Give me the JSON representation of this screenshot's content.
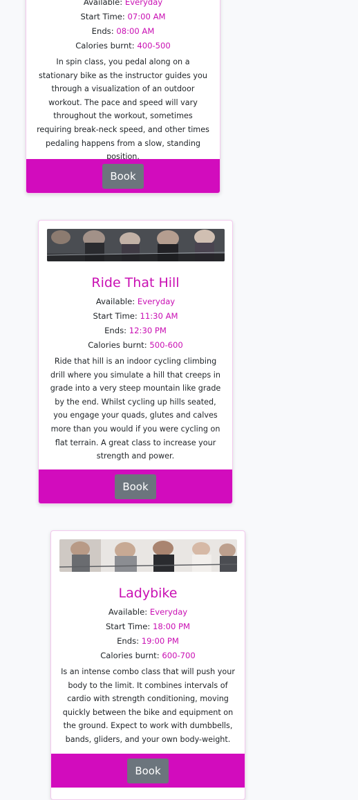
{
  "classes": [
    {
      "title": "",
      "available_label": "Available:",
      "available": "Everyday",
      "start_label": "Start Time:",
      "start": "07:00 AM",
      "ends_label": "Ends:",
      "ends": "08:00 AM",
      "calories_label": "Calories burnt:",
      "calories": "400-500",
      "description": "In spin class, you pedal along on a stationary bike as the instructor guides you through a visualization of an outdoor workout. The pace and speed will vary throughout the workout, sometimes requiring break-neck speed, and other times pedaling happens from a slow, standing position.",
      "book_label": "Book"
    },
    {
      "title": "Ride That Hill",
      "available_label": "Available:",
      "available": "Everyday",
      "start_label": "Start Time:",
      "start": "11:30 AM",
      "ends_label": "Ends:",
      "ends": "12:30 PM",
      "calories_label": "Calories burnt:",
      "calories": "500-600",
      "description": "Ride that hill is an indoor cycling climbing drill where you simulate a hill that creeps in grade into a very steep mountain like grade by the end. Whilst cycling up hills seated, you engage your quads, glutes and calves more than you would if you were cycling on flat terrain. A great class to increase your strength and power.",
      "book_label": "Book"
    },
    {
      "title": "Ladybike",
      "available_label": "Available:",
      "available": "Everyday",
      "start_label": "Start Time:",
      "start": "18:00 PM",
      "ends_label": "Ends:",
      "ends": "19:00 PM",
      "calories_label": "Calories burnt:",
      "calories": "600-700",
      "description": "Is an intense combo class that will push your body to the limit. It combines intervals of cardio with strength conditioning, moving quickly between the bike and equipment on the ground. Expect to work with dumbbells, bands, gliders, and your own body-weight.",
      "book_label": "Book"
    }
  ],
  "colors": {
    "accent": "#c90fb3",
    "footer": "#d20cbd",
    "button": "#6c757d"
  }
}
